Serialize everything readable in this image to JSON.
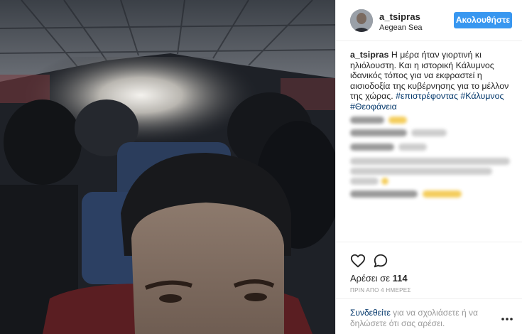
{
  "post": {
    "username": "a_tsipras",
    "location": "Aegean Sea",
    "follow_label": "Ακολουθήστε",
    "caption_user": "a_tsipras",
    "caption_text": " Η μέρα ήταν γιορτινή κι ηλιόλουστη. Και η ιστορική Κάλυμνος ιδανικός τόπος για να εκφραστεί η αισιοδοξία της κυβέρνησης για το μέλλον της χώρας. ",
    "hashtags": [
      "#επιστρέφοντας",
      "#Κάλυμνος",
      "#Θεοφάνεια"
    ],
    "likes_label": "Αρέσει σε ",
    "likes_count": "114",
    "time_label": "ΠΡΙΝ ΑΠΟ 4 ΗΜΕΡΕΣ",
    "login_link": "Συνδεθείτε",
    "login_text": " για να σχολιάσετε ή να δηλώσετε ότι σας αρέσει."
  },
  "icons": {
    "like": "heart-icon",
    "comment": "comment-icon",
    "options": "more-options-icon"
  },
  "colors": {
    "follow_button": "#3897f0",
    "hashtag": "#003569",
    "muted": "#999999"
  }
}
